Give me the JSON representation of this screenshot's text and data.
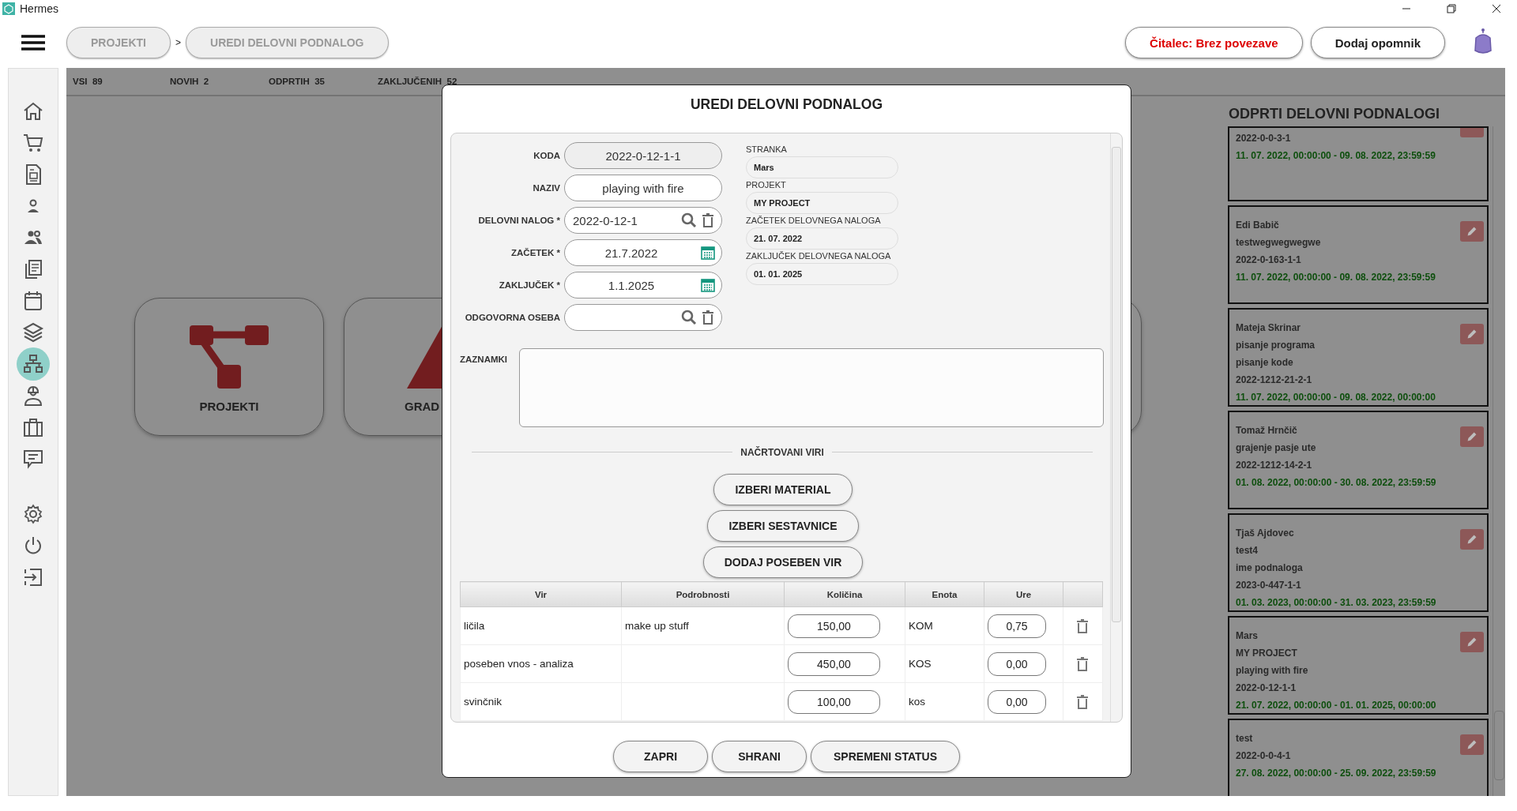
{
  "window": {
    "title": "Hermes"
  },
  "breadcrumbs": [
    {
      "label": "PROJEKTI"
    },
    {
      "label": "UREDI DELOVNI PODNALOG"
    }
  ],
  "breadcrumb_separator": ">",
  "header_buttons": [
    {
      "label": "Čitalec: Brez povezave",
      "kind": "alert"
    },
    {
      "label": "Dodaj opomnik",
      "kind": "normal"
    }
  ],
  "sidebar": {
    "items": [
      {
        "kind": "home",
        "selected": false
      },
      {
        "kind": "cart",
        "selected": false
      },
      {
        "kind": "document",
        "selected": false
      },
      {
        "kind": "person",
        "selected": false
      },
      {
        "kind": "people",
        "selected": false
      },
      {
        "kind": "copies",
        "selected": false
      },
      {
        "kind": "calendar",
        "selected": false
      },
      {
        "kind": "layers",
        "selected": false
      },
      {
        "kind": "hierarchy",
        "selected": true
      },
      {
        "kind": "worker",
        "selected": false
      },
      {
        "kind": "briefcase",
        "selected": false
      },
      {
        "kind": "chat",
        "selected": false
      },
      {
        "kind": "settings",
        "selected": false
      },
      {
        "kind": "power",
        "selected": false
      },
      {
        "kind": "login",
        "selected": false
      }
    ]
  },
  "stats": [
    {
      "label": "VSI",
      "count": "89"
    },
    {
      "label": "NOVIH",
      "count": "2"
    },
    {
      "label": "ODPRTIH",
      "count": "35"
    },
    {
      "label": "ZAKLJUČENIH",
      "count": "52"
    }
  ],
  "tiles": [
    {
      "label": "PROJEKTI",
      "kind": "projects"
    },
    {
      "label": "GRAD",
      "kind": "construction"
    },
    {
      "kind": "blank"
    }
  ],
  "open_panel": {
    "title": "ODPRTI DELOVNI PODNALOGI",
    "items": [
      {
        "lines": [
          "2022-0-0-3-1"
        ],
        "date": "11. 07. 2022, 00:00:00 - 09. 08. 2022, 23:59:59"
      },
      {
        "lines": [
          "Edi Babič",
          "testwegwegwegwe",
          "2022-0-163-1-1"
        ],
        "date": "11. 07. 2022, 00:00:00 - 09. 08. 2022, 23:59:59"
      },
      {
        "lines": [
          "Mateja Skrinar",
          "pisanje programa",
          "pisanje kode",
          "2022-1212-21-2-1"
        ],
        "date": "11. 07. 2022, 00:00:00 - 09. 08. 2022, 00:00:00"
      },
      {
        "lines": [
          "Tomaž Hrnčič",
          "grajenje pasje ute",
          "2022-1212-14-2-1"
        ],
        "date": "01. 08. 2022, 00:00:00 - 30. 08. 2022, 23:59:59"
      },
      {
        "lines": [
          "Tjaš Ajdovec",
          "test4",
          "ime podnaloga",
          "2023-0-447-1-1"
        ],
        "date": "01. 03. 2023, 00:00:00 - 31. 03. 2023, 23:59:59"
      },
      {
        "lines": [
          "Mars",
          "MY PROJECT",
          "playing with fire",
          "2022-0-12-1-1"
        ],
        "date": "21. 07. 2022, 00:00:00 - 01. 01. 2025, 00:00:00"
      },
      {
        "lines": [
          "test",
          "2022-0-0-4-1"
        ],
        "date": "27. 08. 2022, 00:00:00 - 25. 09. 2022, 23:59:59"
      }
    ]
  },
  "dialog": {
    "title": "UREDI DELOVNI PODNALOG",
    "fields": [
      {
        "label": "KODA",
        "value": "2022-0-12-1-1",
        "kind": "readonly"
      },
      {
        "label": "NAZIV",
        "value": "playing with fire",
        "kind": "text"
      },
      {
        "label": "DELOVNI NALOG *",
        "value": "2022-0-12-1",
        "kind": "lookup"
      },
      {
        "label": "ZAČETEK *",
        "value": "21.7.2022",
        "kind": "date"
      },
      {
        "label": "ZAKLJUČEK *",
        "value": "1.1.2025",
        "kind": "date"
      },
      {
        "label": "ODGOVORNA OSEBA",
        "kind": "lookup"
      }
    ],
    "info": [
      {
        "label": "STRANKA",
        "value": "Mars"
      },
      {
        "label": "PROJEKT",
        "value": "MY PROJECT"
      },
      {
        "label": "ZAČETEK DELOVNEGA NALOGA",
        "value": "21. 07. 2022"
      },
      {
        "label": "ZAKLJUČEK DELOVNEGA NALOGA",
        "value": "01. 01. 2025"
      }
    ],
    "notes": {
      "label": "ZAZNAMKI"
    },
    "section_title": "NAČRTOVANI VIRI",
    "resource_buttons": [
      "IZBERI MATERIAL",
      "IZBERI SESTAVNICE",
      "DODAJ POSEBEN VIR"
    ],
    "table": {
      "columns": [
        "Vir",
        "Podrobnosti",
        "Količina",
        "Enota",
        "Ure"
      ],
      "rows": [
        {
          "source": "ličila",
          "details": "make up stuff",
          "quantity": "150,00",
          "unit": "KOM",
          "hours": "0,75"
        },
        {
          "source": "poseben vnos - analiza",
          "quantity": "450,00",
          "unit": "KOS",
          "hours": "0,00"
        },
        {
          "source": "svinčnik",
          "quantity": "100,00",
          "unit": "kos",
          "hours": "0,00"
        }
      ]
    },
    "footer_buttons": [
      "ZAPRI",
      "SHRANI",
      "SPREMENI STATUS"
    ]
  }
}
